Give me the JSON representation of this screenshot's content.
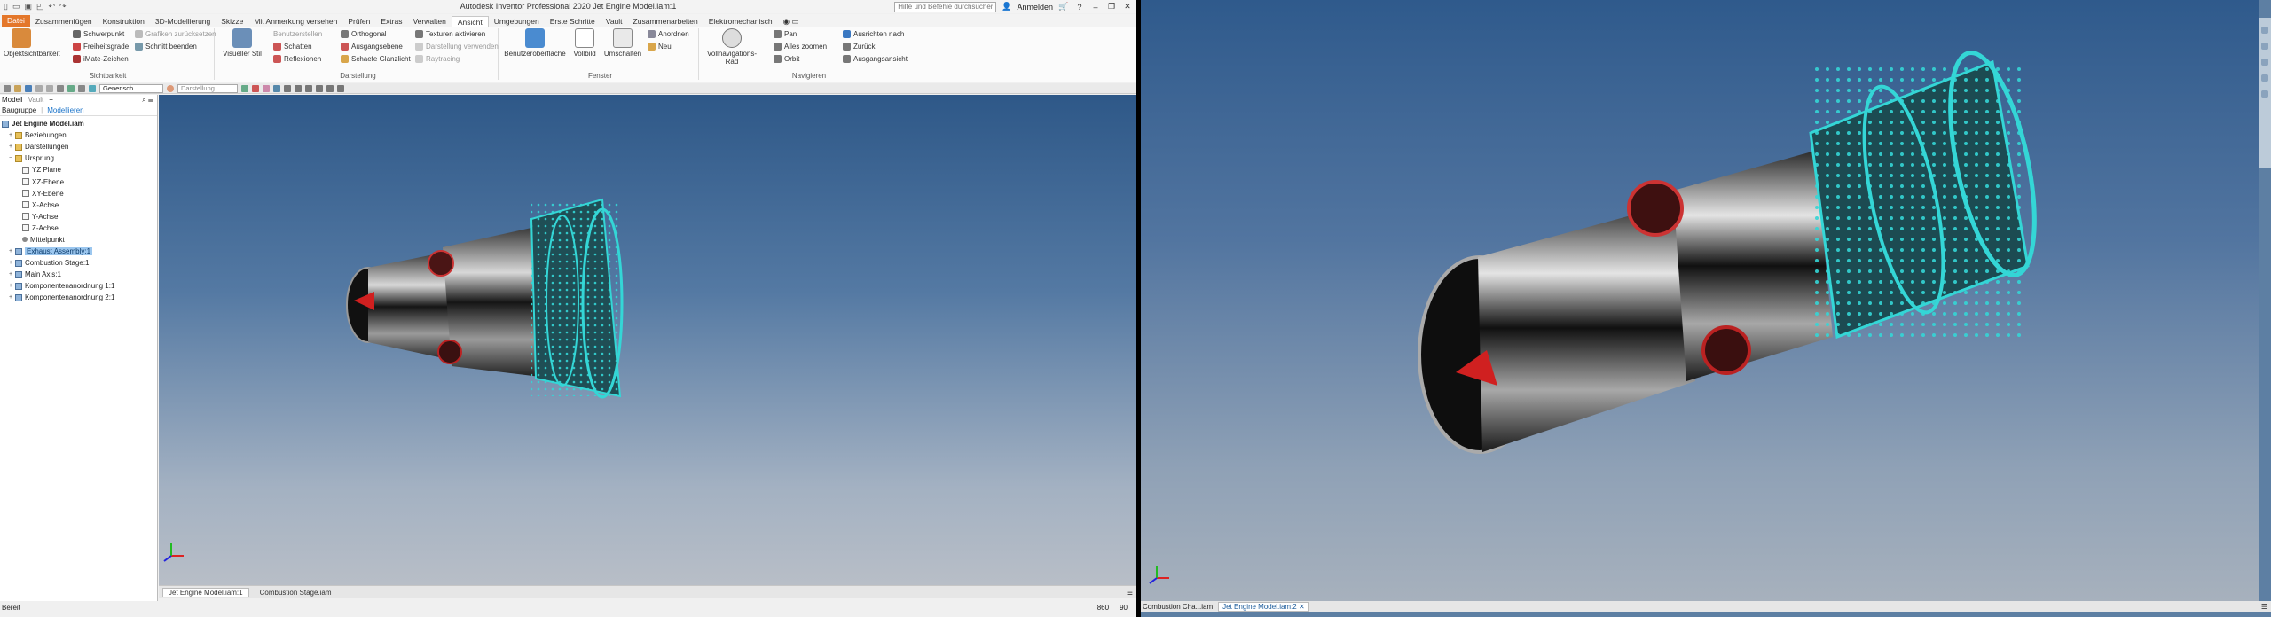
{
  "left": {
    "title": "Autodesk Inventor Professional 2020   Jet Engine Model.iam:1",
    "search_placeholder": "Hilfe und Befehle durchsuchen...",
    "sign_in": "Anmelden",
    "qat": [
      "▯",
      "▭",
      "▣",
      "◰",
      "↶",
      "↷"
    ],
    "tabs": [
      "Datei",
      "Zusammenfügen",
      "Konstruktion",
      "3D-Modellierung",
      "Skizze",
      "Mit Anmerkung versehen",
      "Prüfen",
      "Extras",
      "Verwalten",
      "Ansicht",
      "Umgebungen",
      "Erste Schritte",
      "Vault",
      "Zusammenarbeiten",
      "Elektromechanisch",
      "◉ ▭"
    ],
    "active_tab": "Ansicht",
    "ribbon": {
      "sichtbarkeit": {
        "title": "Sichtbarkeit",
        "big": "Objektsichtbarkeit",
        "items": [
          "Schwerpunkt",
          "Freiheitsgrade",
          "iMate-Zeichen"
        ],
        "items2": [
          "Grafiken zurücksetzen",
          "Schnitt beenden"
        ]
      },
      "darstellung": {
        "title": "Darstellung",
        "big": "Visueller Stil",
        "col1": [
          "Benutzerstellen",
          "Schatten",
          "Reflexionen"
        ],
        "col2": [
          "Orthogonal",
          "Ausgangsebene",
          "Schaefe Glanzlicht"
        ],
        "col3": [
          "Texturen aktivieren",
          "Darstellung verwenden",
          "Raytracing"
        ]
      },
      "fenster": {
        "title": "Fenster",
        "big": [
          "Benutzeroberfläche",
          "Vollbild",
          "Umschalten"
        ],
        "small": [
          "Anordnen",
          "Neu"
        ]
      },
      "navigieren": {
        "title": "Navigieren",
        "big": "Vollnavigations-Rad",
        "col1": [
          "Pan",
          "Alles zoomen",
          "Orbit"
        ],
        "col2": [
          "Ausrichten nach",
          "Zurück",
          "Ausgangsansicht"
        ]
      }
    },
    "toolbar": {
      "style": "Generisch",
      "appearance": "Darstellung"
    },
    "browser": {
      "tabs": [
        "Modell",
        "Vault",
        "+"
      ],
      "sub": [
        "Baugruppe",
        "Modellieren"
      ],
      "root": "Jet Engine Model.iam",
      "nodes": [
        {
          "label": "Beziehungen",
          "indent": 1,
          "icon": "folder",
          "exp": "+"
        },
        {
          "label": "Darstellungen",
          "indent": 1,
          "icon": "folder",
          "exp": "+"
        },
        {
          "label": "Ursprung",
          "indent": 1,
          "icon": "folder",
          "exp": "−"
        },
        {
          "label": "YZ Plane",
          "indent": 2,
          "icon": "plane",
          "exp": ""
        },
        {
          "label": "XZ-Ebene",
          "indent": 2,
          "icon": "plane",
          "exp": ""
        },
        {
          "label": "XY-Ebene",
          "indent": 2,
          "icon": "plane",
          "exp": ""
        },
        {
          "label": "X-Achse",
          "indent": 2,
          "icon": "plane",
          "exp": ""
        },
        {
          "label": "Y-Achse",
          "indent": 2,
          "icon": "plane",
          "exp": ""
        },
        {
          "label": "Z-Achse",
          "indent": 2,
          "icon": "plane",
          "exp": ""
        },
        {
          "label": "Mittelpunkt",
          "indent": 2,
          "icon": "pt",
          "exp": ""
        },
        {
          "label": "Exhaust Assembly:1",
          "indent": 1,
          "icon": "asm",
          "exp": "+",
          "selected": true
        },
        {
          "label": "Combustion Stage:1",
          "indent": 1,
          "icon": "asm",
          "exp": "+"
        },
        {
          "label": "Main Axis:1",
          "indent": 1,
          "icon": "asm",
          "exp": "+"
        },
        {
          "label": "Komponentenanordnung 1:1",
          "indent": 1,
          "icon": "asm",
          "exp": "+"
        },
        {
          "label": "Komponentenanordnung 2:1",
          "indent": 1,
          "icon": "asm",
          "exp": "+"
        }
      ]
    },
    "doc_tabs": [
      "Jet Engine Model.iam:1",
      "Combustion Stage.iam"
    ],
    "status": "Bereit",
    "coords": [
      "860",
      "90"
    ]
  },
  "right": {
    "doc_tabs": [
      "Combustion Cha...iam",
      "Jet Engine Model.iam:2 ✕"
    ]
  },
  "colors": {
    "accent_orange": "#e4772a",
    "highlight_cyan": "#34d6d6",
    "selection_blue": "#9cc7ef"
  }
}
